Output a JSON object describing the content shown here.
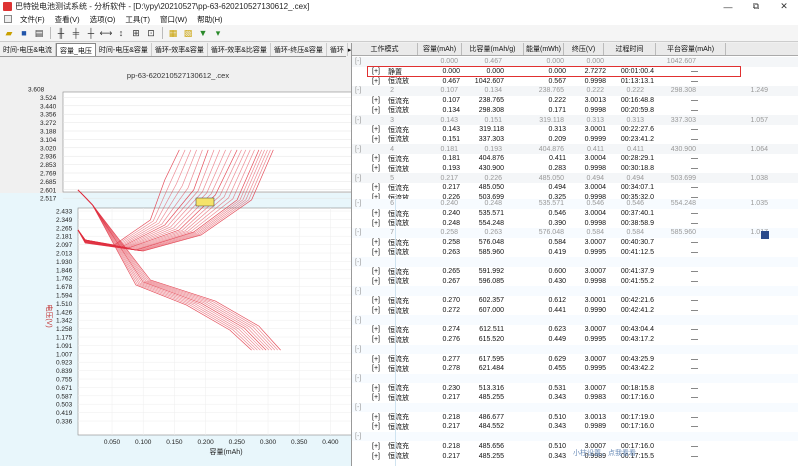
{
  "window": {
    "title": "巴特锐电池测试系统 - 分析软件 - [D:\\ypy\\20210527\\pp-63-620210527130612_.cex]",
    "buttons": [
      "—",
      "⧉",
      "✕"
    ]
  },
  "menu": [
    "文件(F)",
    "查看(V)",
    "选项(O)",
    "工具(T)",
    "窗口(W)",
    "帮助(H)"
  ],
  "left_tabs": [
    "时间-电压&电流",
    "容量_电压",
    "时间-电压&容量",
    "循环-效率&容量",
    "循环-效率&比容量",
    "循环-终压&容量",
    "循环"
  ],
  "active_tab": 1,
  "chart_data": {
    "type": "line",
    "title": "pp-63-620210527130612_.cex",
    "xlabel": "容量(mAh)",
    "ylabel": "电压(V)",
    "y_ticks_top": [
      "3.608",
      "3.524",
      "3.440",
      "3.356",
      "3.272",
      "3.188",
      "3.104",
      "3.020",
      "2.936",
      "2.853",
      "2.769",
      "2.685",
      "2.601",
      "2.517"
    ],
    "y_ticks_bottom": [
      "2.433",
      "2.349",
      "2.265",
      "2.181",
      "2.097",
      "2.013",
      "1.930",
      "1.846",
      "1.762",
      "1.678",
      "1.594",
      "1.510",
      "1.426",
      "1.342",
      "1.258",
      "1.175",
      "1.091",
      "1.007",
      "0.923",
      "0.839",
      "0.755",
      "0.671",
      "0.587",
      "0.503",
      "0.419",
      "0.336"
    ],
    "x_ticks": [
      "0.050",
      "0.100",
      "0.150",
      "0.200",
      "0.250",
      "0.300",
      "0.350",
      "0.400",
      "0.450"
    ],
    "xlim": [
      0,
      0.47
    ],
    "ylim": [
      0.336,
      3.608
    ],
    "series_color": "#e03040",
    "series": [
      {
        "mode": "charge",
        "end_capacity": 0.14,
        "x": [
          0,
          0.01,
          0.05,
          0.1,
          0.12,
          0.14
        ],
        "y": [
          2.2,
          2.1,
          2.05,
          2.3,
          2.7,
          3.0
        ]
      },
      {
        "mode": "charge",
        "end_capacity": 0.18,
        "x": [
          0,
          0.01,
          0.06,
          0.12,
          0.16,
          0.18
        ],
        "y": [
          2.2,
          2.1,
          2.03,
          2.25,
          2.6,
          3.0
        ]
      },
      {
        "mode": "charge",
        "end_capacity": 0.22,
        "x": [
          0,
          0.01,
          0.07,
          0.14,
          0.19,
          0.22
        ],
        "y": [
          2.2,
          2.09,
          2.02,
          2.2,
          2.55,
          3.0
        ]
      },
      {
        "mode": "charge",
        "end_capacity": 0.25,
        "x": [
          0,
          0.01,
          0.08,
          0.16,
          0.22,
          0.25
        ],
        "y": [
          2.2,
          2.08,
          2.0,
          2.18,
          2.5,
          3.0
        ]
      },
      {
        "mode": "charge",
        "end_capacity": 0.27,
        "x": [
          0,
          0.01,
          0.09,
          0.17,
          0.24,
          0.27
        ],
        "y": [
          2.2,
          2.07,
          1.99,
          2.15,
          2.5,
          3.0
        ]
      },
      {
        "mode": "discharge",
        "end_capacity": 0.24,
        "x": [
          0,
          0.02,
          0.08,
          0.15,
          0.21,
          0.24
        ],
        "y": [
          2.6,
          2.45,
          1.65,
          1.45,
          1.2,
          1.0
        ]
      },
      {
        "mode": "discharge",
        "end_capacity": 0.26,
        "x": [
          0,
          0.02,
          0.09,
          0.17,
          0.23,
          0.26
        ],
        "y": [
          2.6,
          2.45,
          1.68,
          1.47,
          1.22,
          1.0
        ]
      },
      {
        "mode": "discharge",
        "end_capacity": 0.28,
        "x": [
          0,
          0.02,
          0.1,
          0.19,
          0.25,
          0.28
        ],
        "y": [
          2.6,
          2.45,
          1.7,
          1.49,
          1.24,
          1.0
        ]
      }
    ]
  },
  "grid": {
    "columns": [
      "工作模式",
      "容量(mAh)",
      "比容量(mAh/g)",
      "能量(mWh)",
      "终压(V)",
      "过程时间",
      "平台容量(mAh)"
    ],
    "rows": [
      {
        "kind": "cycle",
        "expand": "[-]",
        "values": [
          "",
          "0.000",
          "0.467",
          "0.000",
          "0.000",
          "",
          "1042.607",
          ""
        ]
      },
      {
        "kind": "step",
        "expand": "[+]",
        "mode": "静置",
        "values": [
          "0.000",
          "0.000",
          "0.000",
          "2.7272",
          "00:01:00.4",
          "—"
        ],
        "selected": true
      },
      {
        "kind": "step",
        "expand": "[+]",
        "mode": "恒流放",
        "values": [
          "0.467",
          "1042.607",
          "0.567",
          "0.9998",
          "01:13:13.1",
          "—"
        ]
      },
      {
        "kind": "cycle",
        "expand": "[-]",
        "values": [
          "2",
          "0.107",
          "0.134",
          "238.765",
          "0.222",
          "0.222",
          "298.308",
          "1.249"
        ]
      },
      {
        "kind": "step",
        "expand": "[+]",
        "mode": "恒流充",
        "values": [
          "0.107",
          "238.765",
          "0.222",
          "3.0013",
          "00:16:48.8",
          "—"
        ]
      },
      {
        "kind": "step",
        "expand": "[+]",
        "mode": "恒流放",
        "values": [
          "0.134",
          "298.308",
          "0.171",
          "0.9998",
          "00:20:59.8",
          "—"
        ]
      },
      {
        "kind": "cycle",
        "expand": "[-]",
        "values": [
          "3",
          "0.143",
          "0.151",
          "319.118",
          "0.313",
          "0.313",
          "337.303",
          "1.057"
        ]
      },
      {
        "kind": "step",
        "expand": "[+]",
        "mode": "恒流充",
        "values": [
          "0.143",
          "319.118",
          "0.313",
          "3.0001",
          "00:22:27.6",
          "—"
        ]
      },
      {
        "kind": "step",
        "expand": "[+]",
        "mode": "恒流放",
        "values": [
          "0.151",
          "337.303",
          "0.209",
          "0.9999",
          "00:23:41.2",
          "—"
        ]
      },
      {
        "kind": "cycle",
        "expand": "[-]",
        "values": [
          "4",
          "0.181",
          "0.193",
          "404.876",
          "0.411",
          "0.411",
          "430.900",
          "1.064"
        ]
      },
      {
        "kind": "step",
        "expand": "[+]",
        "mode": "恒流充",
        "values": [
          "0.181",
          "404.876",
          "0.411",
          "3.0004",
          "00:28:29.1",
          "—"
        ]
      },
      {
        "kind": "step",
        "expand": "[+]",
        "mode": "恒流放",
        "values": [
          "0.193",
          "430.900",
          "0.283",
          "0.9998",
          "00:30:18.8",
          "—"
        ]
      },
      {
        "kind": "cycle",
        "expand": "[-]",
        "values": [
          "5",
          "0.217",
          "0.226",
          "485.050",
          "0.494",
          "0.494",
          "503.699",
          "1.038"
        ]
      },
      {
        "kind": "step",
        "expand": "[+]",
        "mode": "恒流充",
        "values": [
          "0.217",
          "485.050",
          "0.494",
          "3.0004",
          "00:34:07.1",
          "—"
        ]
      },
      {
        "kind": "step",
        "expand": "[+]",
        "mode": "恒流放",
        "values": [
          "0.226",
          "503.699",
          "0.325",
          "0.9998",
          "00:35:32.0",
          "—"
        ]
      }
    ],
    "lower_rows": [
      {
        "kind": "cycle",
        "expand": "[-]",
        "values": [
          "6",
          "0.240",
          "0.248",
          "535.571",
          "0.546",
          "0.546",
          "554.248",
          "1.035"
        ]
      },
      {
        "kind": "step",
        "expand": "[+]",
        "mode": "恒流充",
        "values": [
          "0.240",
          "535.571",
          "0.546",
          "3.0004",
          "00:37:40.1",
          "—"
        ]
      },
      {
        "kind": "step",
        "expand": "[+]",
        "mode": "恒流放",
        "values": [
          "0.248",
          "554.248",
          "0.390",
          "0.9998",
          "00:38:58.9",
          "—"
        ]
      },
      {
        "kind": "cycle",
        "expand": "[-]",
        "values": [
          "7",
          "0.258",
          "0.263",
          "576.048",
          "0.584",
          "0.584",
          "585.960",
          "1.017"
        ]
      },
      {
        "kind": "step",
        "expand": "[+]",
        "mode": "恒流充",
        "values": [
          "0.258",
          "576.048",
          "0.584",
          "3.0007",
          "00:40:30.7",
          "—"
        ]
      },
      {
        "kind": "step",
        "expand": "[+]",
        "mode": "恒流放",
        "values": [
          "0.263",
          "585.960",
          "0.419",
          "0.9995",
          "00:41:12.5",
          "—"
        ]
      },
      {
        "kind": "cycle",
        "expand": "[-]",
        "values": [
          "",
          "",
          "",
          "",
          "",
          "",
          "",
          ""
        ]
      },
      {
        "kind": "step",
        "expand": "[+]",
        "mode": "恒流充",
        "values": [
          "0.265",
          "591.992",
          "0.600",
          "3.0007",
          "00:41:37.9",
          "—"
        ]
      },
      {
        "kind": "step",
        "expand": "[+]",
        "mode": "恒流放",
        "values": [
          "0.267",
          "596.085",
          "0.430",
          "0.9998",
          "00:41:55.2",
          "—"
        ]
      },
      {
        "kind": "cycle",
        "expand": "[-]",
        "values": [
          "",
          "",
          "",
          "",
          "",
          "",
          "",
          ""
        ]
      },
      {
        "kind": "step",
        "expand": "[+]",
        "mode": "恒流充",
        "values": [
          "0.270",
          "602.357",
          "0.612",
          "3.0001",
          "00:42:21.6",
          "—"
        ]
      },
      {
        "kind": "step",
        "expand": "[+]",
        "mode": "恒流放",
        "values": [
          "0.272",
          "607.000",
          "0.441",
          "0.9990",
          "00:42:41.2",
          "—"
        ]
      },
      {
        "kind": "cycle",
        "expand": "[-]",
        "values": [
          "",
          "",
          "",
          "",
          "",
          "",
          "",
          ""
        ]
      },
      {
        "kind": "step",
        "expand": "[+]",
        "mode": "恒流充",
        "values": [
          "0.274",
          "612.511",
          "0.623",
          "3.0007",
          "00:43:04.4",
          "—"
        ]
      },
      {
        "kind": "step",
        "expand": "[+]",
        "mode": "恒流放",
        "values": [
          "0.276",
          "615.520",
          "0.449",
          "0.9995",
          "00:43:17.2",
          "—"
        ]
      },
      {
        "kind": "cycle",
        "expand": "[-]",
        "values": [
          "",
          "",
          "",
          "",
          "",
          "",
          "",
          ""
        ]
      },
      {
        "kind": "step",
        "expand": "[+]",
        "mode": "恒流充",
        "values": [
          "0.277",
          "617.595",
          "0.629",
          "3.0007",
          "00:43:25.9",
          "—"
        ]
      },
      {
        "kind": "step",
        "expand": "[+]",
        "mode": "恒流放",
        "values": [
          "0.278",
          "621.484",
          "0.455",
          "0.9995",
          "00:43:42.2",
          "—"
        ]
      },
      {
        "kind": "cycle",
        "expand": "[-]",
        "values": [
          "",
          "",
          "",
          "",
          "",
          "",
          "",
          ""
        ]
      },
      {
        "kind": "step",
        "expand": "[+]",
        "mode": "恒流充",
        "values": [
          "0.230",
          "513.316",
          "0.531",
          "3.0007",
          "00:18:15.8",
          "—"
        ]
      },
      {
        "kind": "step",
        "expand": "[+]",
        "mode": "恒流放",
        "values": [
          "0.217",
          "485.255",
          "0.343",
          "0.9983",
          "00:17:16.0",
          "—"
        ]
      },
      {
        "kind": "cycle",
        "expand": "[-]",
        "values": [
          "",
          "",
          "",
          "",
          "",
          "",
          "",
          ""
        ]
      },
      {
        "kind": "step",
        "expand": "[+]",
        "mode": "恒流充",
        "values": [
          "0.218",
          "486.677",
          "0.510",
          "3.0013",
          "00:17:19.0",
          "—"
        ]
      },
      {
        "kind": "step",
        "expand": "[+]",
        "mode": "恒流放",
        "values": [
          "0.217",
          "484.552",
          "0.343",
          "0.9989",
          "00:17:16.0",
          "—"
        ]
      },
      {
        "kind": "cycle",
        "expand": "[-]",
        "values": [
          "",
          "",
          "",
          "",
          "",
          "",
          "",
          ""
        ]
      },
      {
        "kind": "step",
        "expand": "[+]",
        "mode": "恒流充",
        "values": [
          "0.218",
          "485.656",
          "0.510",
          "3.0007",
          "00:17:16.0",
          "—"
        ]
      },
      {
        "kind": "step",
        "expand": "[+]",
        "mode": "恒流放",
        "values": [
          "0.217",
          "485.255",
          "0.343",
          "0.9989",
          "00:17:15.5",
          "—"
        ]
      }
    ]
  },
  "status_hint": "小柱设置，点我看看"
}
